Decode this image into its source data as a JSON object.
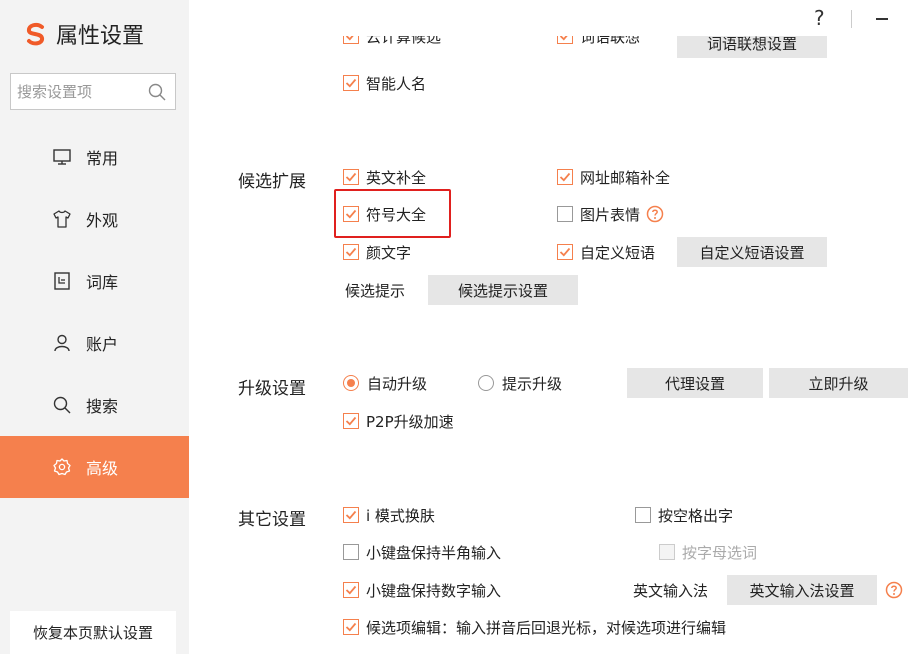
{
  "sidebar": {
    "title": "属性设置",
    "search_placeholder": "搜索设置项",
    "items": [
      {
        "label": "常用",
        "icon": "monitor-icon"
      },
      {
        "label": "外观",
        "icon": "tshirt-icon"
      },
      {
        "label": "词库",
        "icon": "dictionary-icon"
      },
      {
        "label": "账户",
        "icon": "user-icon"
      },
      {
        "label": "搜索",
        "icon": "search-icon"
      },
      {
        "label": "高级",
        "icon": "gear-icon",
        "active": true
      }
    ],
    "restore_label": "恢复本页默认设置"
  },
  "window": {
    "help": "?"
  },
  "top_partial": {
    "cloud": "云计算候选",
    "phrase": "词语联想",
    "phrase_btn": "词语联想设置",
    "smart_name": "智能人名"
  },
  "candidate_ext": {
    "title": "候选扩展",
    "english_complete": "英文补全",
    "url_email": "网址邮箱补全",
    "symbols": "符号大全",
    "image_emoji": "图片表情",
    "kaomoji": "颜文字",
    "custom_phrase": "自定义短语",
    "custom_phrase_btn": "自定义短语设置",
    "candidate_hint": "候选提示",
    "candidate_hint_btn": "候选提示设置"
  },
  "upgrade": {
    "title": "升级设置",
    "auto": "自动升级",
    "prompt": "提示升级",
    "proxy_btn": "代理设置",
    "now_btn": "立即升级",
    "p2p": "P2P升级加速"
  },
  "other": {
    "title": "其它设置",
    "i_mode": "i 模式换肤",
    "space_output": "按空格出字",
    "half_width": "小键盘保持半角输入",
    "letter_select": "按字母选词",
    "numeric": "小键盘保持数字输入",
    "eng_ime": "英文输入法",
    "eng_ime_btn": "英文输入法设置",
    "candidate_edit": "候选项编辑：输入拼音后回退光标，对候选项进行编辑"
  },
  "colors": {
    "accent": "#f5804d",
    "highlight": "#e0201e",
    "sidebar_bg": "#f3f3f3"
  }
}
